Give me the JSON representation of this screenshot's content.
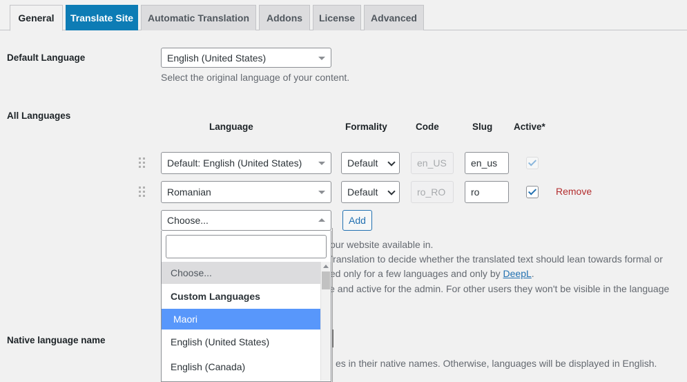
{
  "tabs": [
    {
      "label": "General",
      "state": "current"
    },
    {
      "label": "Translate Site",
      "state": "active"
    },
    {
      "label": "Automatic Translation",
      "state": "normal"
    },
    {
      "label": "Addons",
      "state": "normal"
    },
    {
      "label": "License",
      "state": "normal"
    },
    {
      "label": "Advanced",
      "state": "normal"
    }
  ],
  "default_language": {
    "label": "Default Language",
    "value": "English (United States)",
    "helper": "Select the original language of your content."
  },
  "all_languages": {
    "label": "All Languages",
    "columns": [
      "Language",
      "Formality",
      "Code",
      "Slug",
      "Active*"
    ],
    "rows": [
      {
        "language": "Default: English (United States)",
        "formality": "Default",
        "code": "en_US",
        "slug": "en_us",
        "active": true,
        "active_readonly": true,
        "remove": ""
      },
      {
        "language": "Romanian",
        "formality": "Default",
        "code": "ro_RO",
        "slug": "ro",
        "active": true,
        "active_readonly": false,
        "remove": "Remove"
      }
    ],
    "add_row": {
      "placeholder": "Choose...",
      "add_label": "Add"
    }
  },
  "dropdown": {
    "search_value": "",
    "options": [
      {
        "label": "Choose...",
        "type": "placeholder"
      },
      {
        "label": "Custom Languages",
        "type": "group"
      },
      {
        "label": "Maori",
        "type": "option",
        "selected": true
      },
      {
        "label": "English (United States)",
        "type": "option",
        "selected": false
      },
      {
        "label": "English (Canada)",
        "type": "option",
        "selected": false
      }
    ]
  },
  "descriptions": {
    "line1": "our website available in.",
    "line2": "Translation to decide whether the translated text should lean towards formal or",
    "line3_before": "ted only for a few languages and only by ",
    "line3_link": "DeepL",
    "line3_after": ".",
    "line4": "le and active for the admin. For other users they won't be visible in the language"
  },
  "native_language_name": {
    "label": "Native language name",
    "helper": "es in their native names. Otherwise, languages will be displayed in English."
  },
  "colors": {
    "accent_blue": "#0d7cb5",
    "link_blue": "#2271b1",
    "selected_blue": "#5897fb",
    "remove_red": "#b32d2e",
    "page_bg": "#f1f1f1"
  }
}
